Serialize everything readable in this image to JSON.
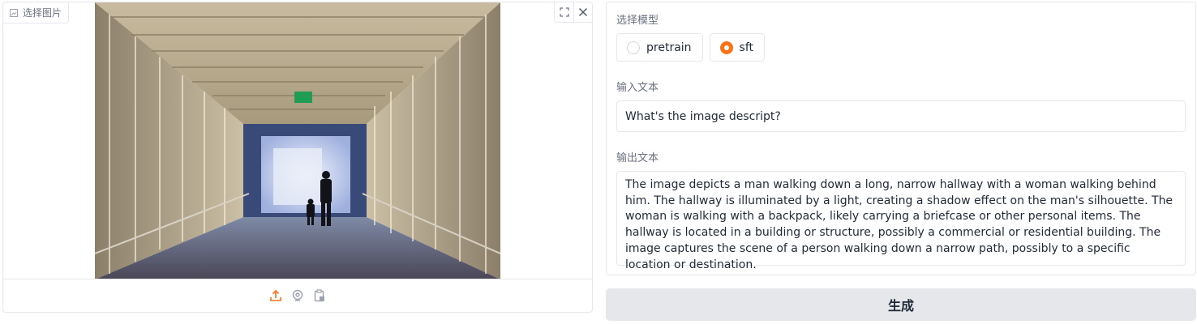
{
  "image_panel": {
    "label": "选择图片",
    "photo_alt": "hallway photo",
    "icons": {
      "label_icon": "image-icon",
      "fullscreen": "fullscreen-icon",
      "clear": "close-icon",
      "upload": "upload-icon",
      "webcam": "webcam-icon",
      "clipboard": "clipboard-icon"
    }
  },
  "model_select": {
    "label": "选择模型",
    "options": [
      {
        "label": "pretrain",
        "checked": false
      },
      {
        "label": "sft",
        "checked": true
      }
    ]
  },
  "input_text": {
    "label": "输入文本",
    "value": "What's the image descript?"
  },
  "output_text": {
    "label": "输出文本",
    "value": "The image depicts a man walking down a long, narrow hallway with a woman walking behind him. The hallway is illuminated by a light, creating a shadow effect on the man's silhouette. The woman is walking with a backpack, likely carrying a briefcase or other personal items. The hallway is located in a building or structure, possibly a commercial or residential building. The image captures the scene of a person walking down a narrow path, possibly to a specific location or destination."
  },
  "generate_button": "生成",
  "colors": {
    "accent": "#f97316",
    "border": "#e5e7eb",
    "button_bg": "#e5e7eb",
    "label": "#6b7280"
  }
}
